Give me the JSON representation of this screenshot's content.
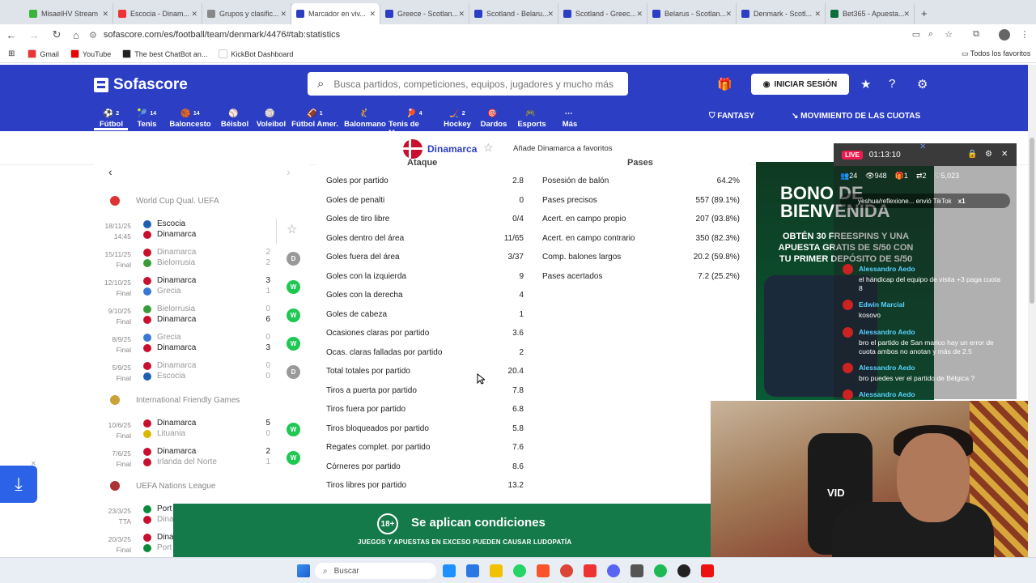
{
  "browser": {
    "tabs": [
      {
        "label": "MisaelHV Stream",
        "color": "#3db33d"
      },
      {
        "label": "Escocia - Dinam...",
        "color": "#e33"
      },
      {
        "label": "Grupos y clasific...",
        "color": "#888"
      },
      {
        "label": "Marcador en viv...",
        "color": "#2c3ec4",
        "active": true
      },
      {
        "label": "Greece - Scotlan...",
        "color": "#2c3ec4"
      },
      {
        "label": "Scotland - Belaru...",
        "color": "#2c3ec4"
      },
      {
        "label": "Scotland - Greec...",
        "color": "#2c3ec4"
      },
      {
        "label": "Belarus - Scotlan...",
        "color": "#2c3ec4"
      },
      {
        "label": "Denmark - Scotl...",
        "color": "#2c3ec4"
      },
      {
        "label": "Bet365 - Apuesta...",
        "color": "#0b6e3b"
      }
    ],
    "url": "sofascore.com/es/football/team/denmark/4476#tab:statistics",
    "bookmarks": [
      {
        "label": "Gmail",
        "color": "#e33"
      },
      {
        "label": "YouTube",
        "color": "#e00"
      },
      {
        "label": "The best ChatBot an...",
        "color": "#222"
      },
      {
        "label": "KickBot Dashboard",
        "color": "#fff"
      }
    ],
    "all_favorites": "Todos los favoritos"
  },
  "header": {
    "logo": "Sofascore",
    "search_placeholder": "Busca partidos, competiciones, equipos, jugadores y mucho más",
    "login": "INICIAR SESIÓN",
    "fantasy": "FANTASY",
    "odds": "MOVIMIENTO DE LAS CUOTAS",
    "sports": [
      {
        "label": "Fútbol",
        "count": "2"
      },
      {
        "label": "Tenis",
        "count": "14"
      },
      {
        "label": "Baloncesto",
        "count": "14"
      },
      {
        "label": "Béisbol",
        "count": ""
      },
      {
        "label": "Voleibol",
        "count": ""
      },
      {
        "label": "Fútbol Amer.",
        "count": "1"
      },
      {
        "label": "Balonmano",
        "count": ""
      },
      {
        "label": "Tenis de Mesa",
        "count": "4"
      },
      {
        "label": "Hockey",
        "count": "2"
      },
      {
        "label": "Dardos",
        "count": ""
      },
      {
        "label": "Esports",
        "count": ""
      },
      {
        "label": "Más",
        "count": ""
      }
    ]
  },
  "team": {
    "name": "Dinamarca",
    "favorite_text": "Añade Dinamarca a favoritos"
  },
  "matches_panel": {
    "competitions": [
      {
        "name": "World Cup Qual. UEFA"
      },
      {
        "name": "International Friendly Games"
      },
      {
        "name": "UEFA Nations League"
      }
    ],
    "matches": [
      {
        "date": "18/11/25",
        "status": "14:45",
        "home": "Escocia",
        "away": "Dinamarca",
        "hs": "",
        "as": "",
        "result": "",
        "dim_home": false,
        "dim_away": false
      },
      {
        "date": "15/11/25",
        "status": "Final",
        "home": "Dinamarca",
        "away": "Bielorrusia",
        "hs": "2",
        "as": "2",
        "result": "D",
        "dim_home": true,
        "dim_away": true
      },
      {
        "date": "12/10/25",
        "status": "Final",
        "home": "Dinamarca",
        "away": "Grecia",
        "hs": "3",
        "as": "1",
        "result": "W",
        "dim_home": false,
        "dim_away": true
      },
      {
        "date": "9/10/25",
        "status": "Final",
        "home": "Bielorrusia",
        "away": "Dinamarca",
        "hs": "0",
        "as": "6",
        "result": "W",
        "dim_home": true,
        "dim_away": false
      },
      {
        "date": "8/9/25",
        "status": "Final",
        "home": "Grecia",
        "away": "Dinamarca",
        "hs": "0",
        "as": "3",
        "result": "W",
        "dim_home": true,
        "dim_away": false
      },
      {
        "date": "5/9/25",
        "status": "Final",
        "home": "Dinamarca",
        "away": "Escocia",
        "hs": "0",
        "as": "0",
        "result": "D",
        "dim_home": true,
        "dim_away": true
      },
      {
        "date": "10/6/25",
        "status": "Final",
        "home": "Dinamarca",
        "away": "Lituania",
        "hs": "5",
        "as": "0",
        "result": "W",
        "dim_home": false,
        "dim_away": true
      },
      {
        "date": "7/6/25",
        "status": "Final",
        "home": "Dinamarca",
        "away": "Irlanda del Norte",
        "hs": "2",
        "as": "1",
        "result": "W",
        "dim_home": false,
        "dim_away": true
      },
      {
        "date": "23/3/25",
        "status": "TTA",
        "home": "Port",
        "away": "Dina",
        "hs": "",
        "as": "",
        "result": "",
        "dim_home": false,
        "dim_away": true
      },
      {
        "date": "20/3/25",
        "status": "Final",
        "home": "Dina",
        "away": "Port",
        "hs": "",
        "as": "",
        "result": "",
        "dim_home": false,
        "dim_away": true
      }
    ]
  },
  "stats": {
    "attack_title": "Ataque",
    "passes_title": "Pases",
    "attack": [
      {
        "label": "Goles por partido",
        "value": "2.8"
      },
      {
        "label": "Goles de penalti",
        "value": "0"
      },
      {
        "label": "Goles de tiro libre",
        "value": "0/4"
      },
      {
        "label": "Goles dentro del área",
        "value": "11/65"
      },
      {
        "label": "Goles fuera del área",
        "value": "3/37"
      },
      {
        "label": "Goles con la izquierda",
        "value": "9"
      },
      {
        "label": "Goles con la derecha",
        "value": "4"
      },
      {
        "label": "Goles de cabeza",
        "value": "1"
      },
      {
        "label": "Ocasiones claras por partido",
        "value": "3.6"
      },
      {
        "label": "Ocas. claras falladas por partido",
        "value": "2"
      },
      {
        "label": "Total totales por partido",
        "value": "20.4"
      },
      {
        "label": "Tiros a puerta por partido",
        "value": "7.8"
      },
      {
        "label": "Tiros fuera por partido",
        "value": "6.8"
      },
      {
        "label": "Tiros bloqueados por partido",
        "value": "5.8"
      },
      {
        "label": "Regates complet. por partido",
        "value": "7.6"
      },
      {
        "label": "Córneres por partido",
        "value": "8.6"
      },
      {
        "label": "Tiros libres por partido",
        "value": "13.2"
      }
    ],
    "passes": [
      {
        "label": "Posesión de balón",
        "value": "64.2%"
      },
      {
        "label": "Pases precisos",
        "value": "557 (89.1%)"
      },
      {
        "label": "Acert. en campo propio",
        "value": "207 (93.8%)"
      },
      {
        "label": "Acert. en campo contrario",
        "value": "350 (82.3%)"
      },
      {
        "label": "Comp. balones largos",
        "value": "20.2 (59.8%)"
      },
      {
        "label": "Pases acertados",
        "value": "7.2 (25.2%)"
      }
    ]
  },
  "live_overlay": {
    "badge": "LIVE",
    "time": "01:13:10",
    "viewers": "24",
    "likes_count": "948",
    "gifts": "1",
    "shares": "2",
    "hearts": "5,023",
    "tiktok_msg": "yeshua/reflexione... envió TikTok",
    "tiktok_count": "x1",
    "ad_big": "BONO DE BIENVENIDA",
    "ad_sub": "OBTÉN 30 FREESPINS Y UNA APUESTA GRATIS DE S/50 CON TU PRIMER DEPÓSITO DE S/50",
    "chat": [
      {
        "user": "Alessandro Aedo",
        "msg": "el hándicap del equipo de visita +3 paga cuota 8"
      },
      {
        "user": "Edwin Marcial",
        "msg": "kosovo"
      },
      {
        "user": "Alessandro Aedo",
        "msg": "bro el partido de San marico hay un error de cuota ambos no anotan y más de 2.5"
      },
      {
        "user": "Alessandro Aedo",
        "msg": "bro puedes ver el partido de Bélgica ?"
      },
      {
        "user": "Alessandro Aedo",
        "msg": ""
      }
    ]
  },
  "promo": {
    "age": "18+",
    "title": "Se aplican condiciones",
    "subtitle": "JUEGOS Y APUESTAS EN EXCESO PUEDEN CAUSAR LUDOPATÍA"
  },
  "webcam": {
    "shirt_text": "VID"
  },
  "taskbar": {
    "search": "Buscar"
  }
}
